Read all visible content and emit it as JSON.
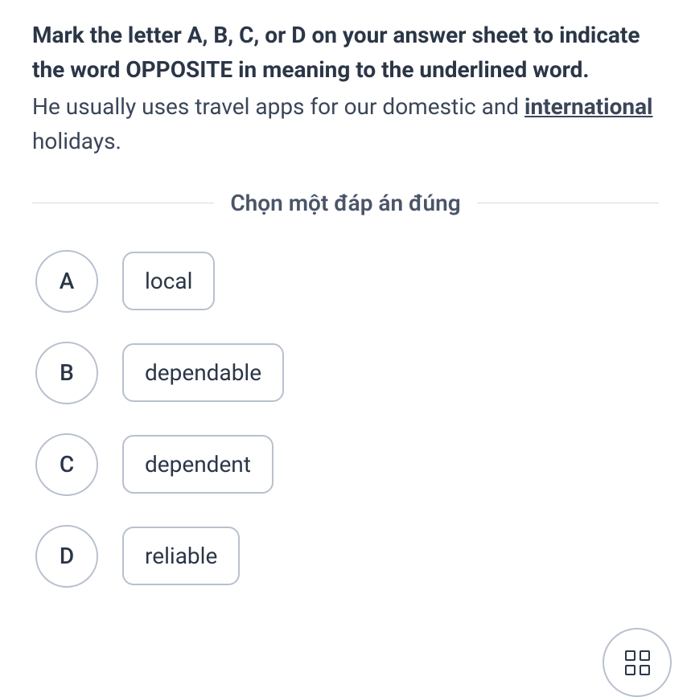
{
  "question": {
    "instruction": "Mark the letter A, B, C, or D on your answer sheet to indicate the word OPPOSITE in meaning to the underlined word.",
    "sentence_pre": "He usually uses travel apps for our domestic and ",
    "underlined_word": "international",
    "sentence_post": " holidays."
  },
  "divider_label": "Chọn một đáp án đúng",
  "options": [
    {
      "letter": "A",
      "text": "local"
    },
    {
      "letter": "B",
      "text": "dependable"
    },
    {
      "letter": "C",
      "text": "dependent"
    },
    {
      "letter": "D",
      "text": "reliable"
    }
  ]
}
